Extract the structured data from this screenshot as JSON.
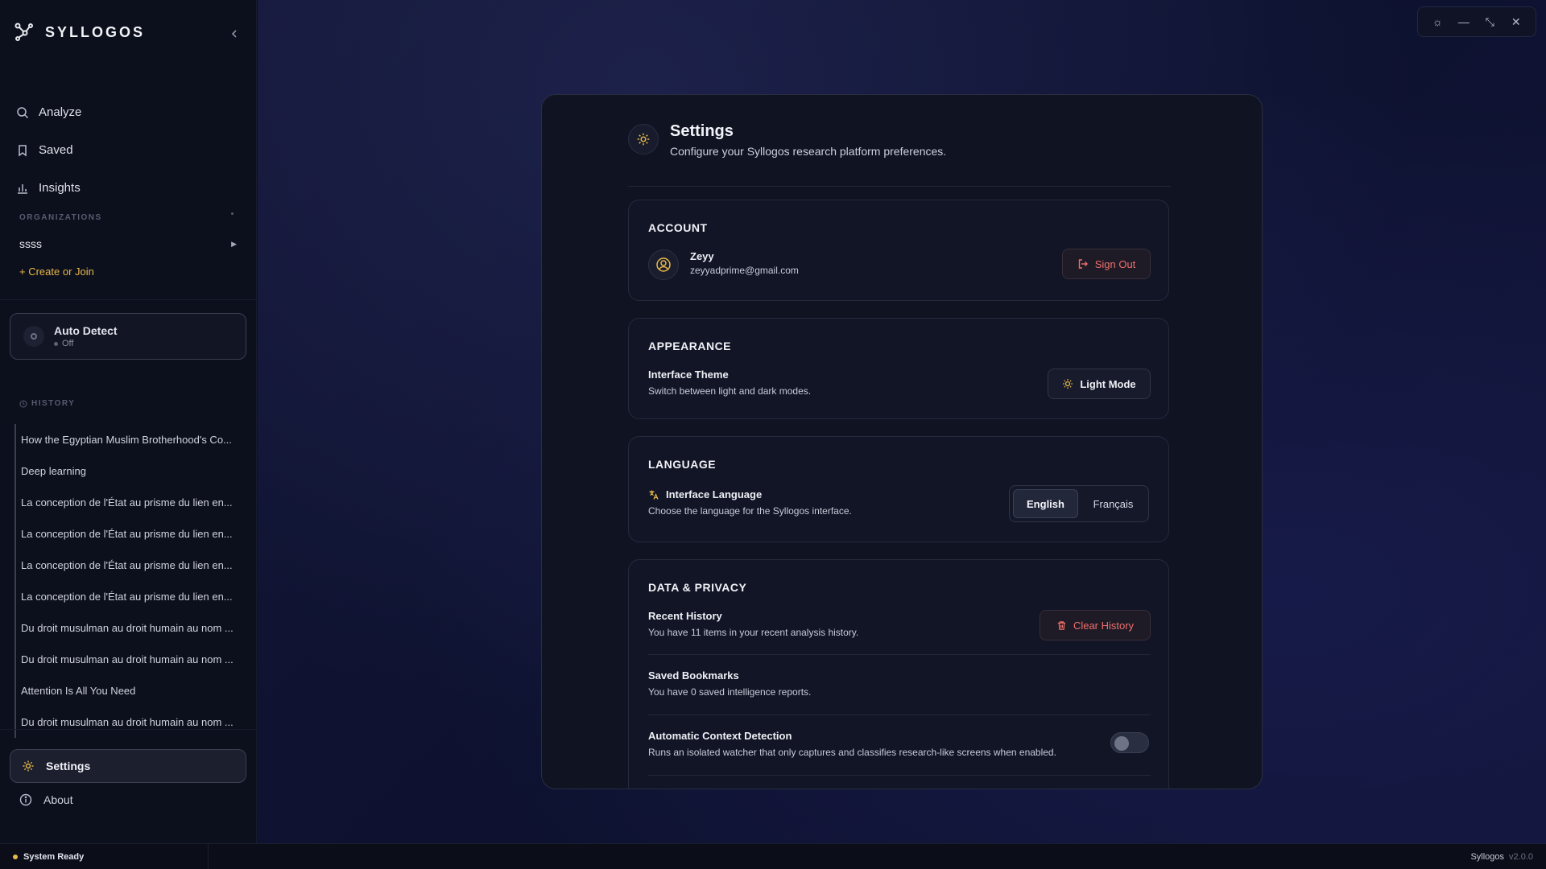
{
  "app": {
    "name": "SYLLOGOS"
  },
  "sidebar": {
    "nav": [
      {
        "label": "Analyze",
        "icon": "search-icon"
      },
      {
        "label": "Saved",
        "icon": "bookmark-icon"
      },
      {
        "label": "Insights",
        "icon": "bar-chart-icon"
      }
    ],
    "organizations_label": "ORGANIZATIONS",
    "org": "ssss",
    "create_join": "+ Create or Join",
    "auto_detect": {
      "title": "Auto Detect",
      "status": "Off"
    },
    "history_label": "HISTORY",
    "history": [
      "How the Egyptian Muslim Brotherhood's Co...",
      "Deep learning",
      "La conception de l'État au prisme du lien en...",
      "La conception de l'État au prisme du lien en...",
      "La conception de l'État au prisme du lien en...",
      "La conception de l'État au prisme du lien en...",
      "Du droit musulman au droit humain au nom ...",
      "Du droit musulman au droit humain au nom ...",
      "Attention Is All You Need",
      "Du droit musulman au droit humain au nom ..."
    ],
    "settings": "Settings",
    "about": "About"
  },
  "settings": {
    "title": "Settings",
    "subtitle": "Configure your Syllogos research platform preferences.",
    "account": {
      "heading": "ACCOUNT",
      "name": "Zeyy",
      "email": "zeyyadprime@gmail.com",
      "sign_out": "Sign Out"
    },
    "appearance": {
      "heading": "APPEARANCE",
      "title": "Interface Theme",
      "sub": "Switch between light and dark modes.",
      "button": "Light Mode"
    },
    "language": {
      "heading": "LANGUAGE",
      "title": "Interface Language",
      "sub": "Choose the language for the Syllogos interface.",
      "options": [
        "English",
        "Français"
      ],
      "selected": "English"
    },
    "privacy": {
      "heading": "DATA & PRIVACY",
      "history_title": "Recent History",
      "history_sub": "You have 11 items in your recent analysis history.",
      "clear_btn": "Clear History",
      "bookmarks_title": "Saved Bookmarks",
      "bookmarks_sub": "You have 0 saved intelligence reports.",
      "acd_title": "Automatic Context Detection",
      "acd_sub": "Runs an isolated watcher that only captures and classifies research-like screens when enabled.",
      "acd_enabled": false
    }
  },
  "statusbar": {
    "status": "System Ready",
    "app": "Syllogos",
    "version": "v2.0.0"
  },
  "colors": {
    "accent": "#e8b84a",
    "danger": "#f0706b",
    "bg": "#0f1124"
  }
}
